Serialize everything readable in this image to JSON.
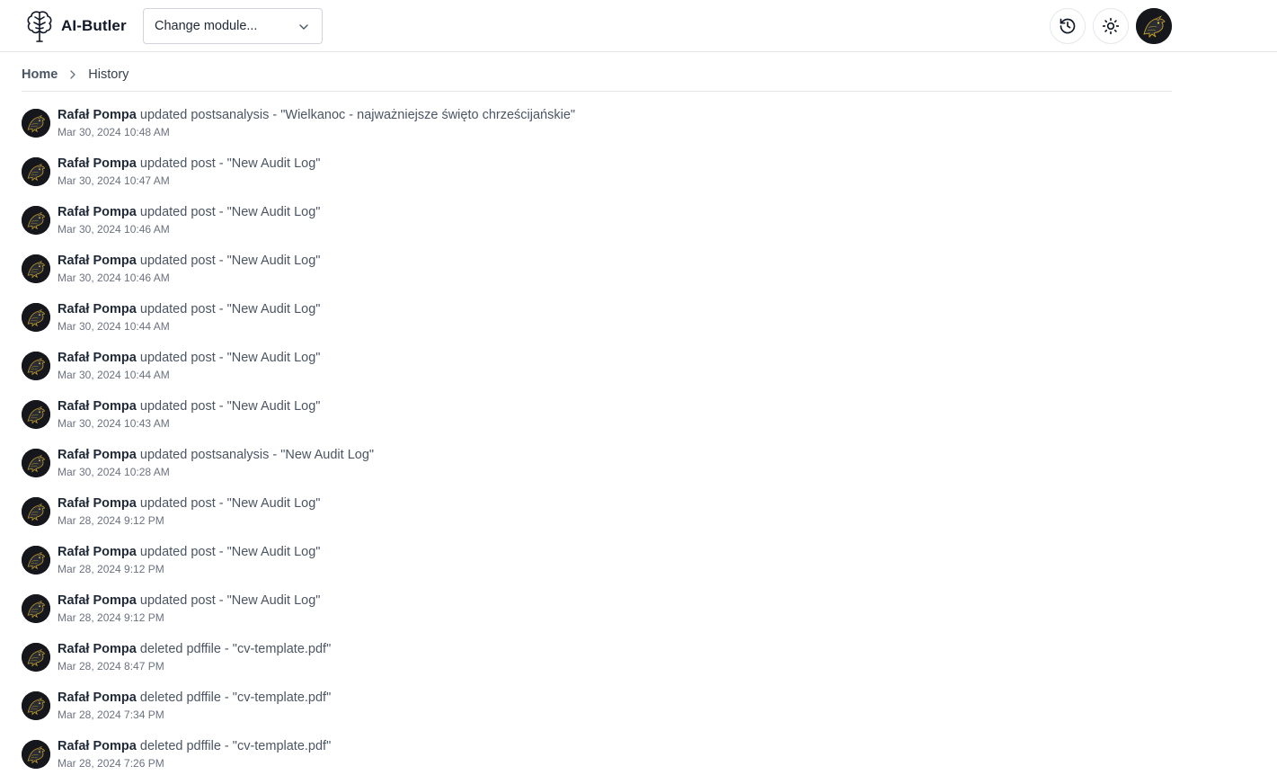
{
  "app": {
    "name": "AI-Butler",
    "logo_icon": "brain-tree-icon"
  },
  "header": {
    "module_select": {
      "value": "Change module...",
      "icon": "chevron-down-icon"
    },
    "history_button_icon": "history-clock-icon",
    "theme_button_icon": "sun-icon",
    "user_avatar_icon": "user-avatar-icon"
  },
  "breadcrumb": {
    "home": "Home",
    "separator_icon": "chevron-right-icon",
    "current": "History"
  },
  "colors": {
    "border": "#e5e7eb",
    "text_primary": "#1f2937",
    "text_secondary": "#4b5563",
    "text_muted": "#6b7280",
    "avatar_bg": "#15171c",
    "avatar_accent": "#c9a227"
  },
  "history": [
    {
      "user": "Rafał Pompa",
      "action": "updated postsanalysis - \"Wielkanoc - najważniejsze święto chrześcijańskie\"",
      "time": "Mar 30, 2024 10:48 AM"
    },
    {
      "user": "Rafał Pompa",
      "action": "updated post - \"New Audit Log\"",
      "time": "Mar 30, 2024 10:47 AM"
    },
    {
      "user": "Rafał Pompa",
      "action": "updated post - \"New Audit Log\"",
      "time": "Mar 30, 2024 10:46 AM"
    },
    {
      "user": "Rafał Pompa",
      "action": "updated post - \"New Audit Log\"",
      "time": "Mar 30, 2024 10:46 AM"
    },
    {
      "user": "Rafał Pompa",
      "action": "updated post - \"New Audit Log\"",
      "time": "Mar 30, 2024 10:44 AM"
    },
    {
      "user": "Rafał Pompa",
      "action": "updated post - \"New Audit Log\"",
      "time": "Mar 30, 2024 10:44 AM"
    },
    {
      "user": "Rafał Pompa",
      "action": "updated post - \"New Audit Log\"",
      "time": "Mar 30, 2024 10:43 AM"
    },
    {
      "user": "Rafał Pompa",
      "action": "updated postsanalysis - \"New Audit Log\"",
      "time": "Mar 30, 2024 10:28 AM"
    },
    {
      "user": "Rafał Pompa",
      "action": "updated post - \"New Audit Log\"",
      "time": "Mar 28, 2024 9:12 PM"
    },
    {
      "user": "Rafał Pompa",
      "action": "updated post - \"New Audit Log\"",
      "time": "Mar 28, 2024 9:12 PM"
    },
    {
      "user": "Rafał Pompa",
      "action": "updated post - \"New Audit Log\"",
      "time": "Mar 28, 2024 9:12 PM"
    },
    {
      "user": "Rafał Pompa",
      "action": "deleted pdffile - \"cv-template.pdf\"",
      "time": "Mar 28, 2024 8:47 PM"
    },
    {
      "user": "Rafał Pompa",
      "action": "deleted pdffile - \"cv-template.pdf\"",
      "time": "Mar 28, 2024 7:34 PM"
    },
    {
      "user": "Rafał Pompa",
      "action": "deleted pdffile - \"cv-template.pdf\"",
      "time": "Mar 28, 2024 7:26 PM"
    }
  ]
}
